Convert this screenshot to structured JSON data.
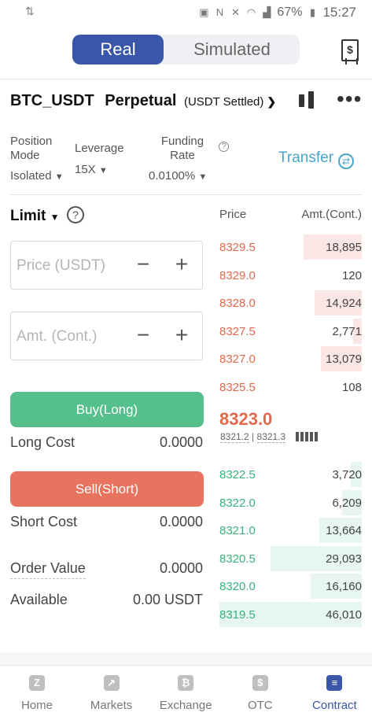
{
  "status_bar": {
    "battery": "67%",
    "time": "15:27"
  },
  "mode_tabs": [
    {
      "label": "Real",
      "active": true
    },
    {
      "label": "Simulated",
      "active": false
    }
  ],
  "contract": {
    "symbol": "BTC_USDT",
    "type": "Perpetual",
    "settlement": "(USDT Settled)"
  },
  "info": {
    "position_mode": {
      "label_line1": "Position",
      "label_line2": "Mode",
      "value": "Isolated"
    },
    "leverage": {
      "label": "Leverage",
      "value": "15X"
    },
    "funding_rate": {
      "label_line1": "Funding",
      "label_line2": "Rate",
      "value": "0.0100%"
    },
    "transfer_label": "Transfer"
  },
  "order_form": {
    "order_type": "Limit",
    "price_placeholder": "Price (USDT)",
    "amount_placeholder": "Amt. (Cont.)",
    "minus": "−",
    "plus": "+",
    "buy_label": "Buy(Long)",
    "long_cost_label": "Long Cost",
    "long_cost_value": "0.0000",
    "sell_label": "Sell(Short)",
    "short_cost_label": "Short Cost",
    "short_cost_value": "0.0000",
    "order_value_label": "Order Value",
    "order_value_value": "0.0000",
    "available_label": "Available",
    "available_value": "0.00 USDT"
  },
  "orderbook": {
    "price_header": "Price",
    "amount_header": "Amt.(Cont.)",
    "asks": [
      {
        "price": "8329.5",
        "amount": "18,895",
        "depth": 0.41
      },
      {
        "price": "8329.0",
        "amount": "120",
        "depth": 0.0
      },
      {
        "price": "8328.0",
        "amount": "14,924",
        "depth": 0.33
      },
      {
        "price": "8327.5",
        "amount": "2,771",
        "depth": 0.06
      },
      {
        "price": "8327.0",
        "amount": "13,079",
        "depth": 0.29
      },
      {
        "price": "8325.5",
        "amount": "108",
        "depth": 0.0
      }
    ],
    "last_price": "8323.0",
    "mark_price": "8321.2",
    "index_price": "8321.3",
    "separator": "|",
    "bids": [
      {
        "price": "8322.5",
        "amount": "3,720",
        "depth": 0.08
      },
      {
        "price": "8322.0",
        "amount": "6,209",
        "depth": 0.14
      },
      {
        "price": "8321.0",
        "amount": "13,664",
        "depth": 0.3
      },
      {
        "price": "8320.5",
        "amount": "29,093",
        "depth": 0.64
      },
      {
        "price": "8320.0",
        "amount": "16,160",
        "depth": 0.36
      },
      {
        "price": "8319.5",
        "amount": "46,010",
        "depth": 1.0
      }
    ]
  },
  "bottom_nav": [
    {
      "label": "Home",
      "icon": "home-icon",
      "glyph": "Z",
      "active": false
    },
    {
      "label": "Markets",
      "icon": "chart-icon",
      "glyph": "↗",
      "active": false
    },
    {
      "label": "Exchange",
      "icon": "bitcoin-icon",
      "glyph": "₿",
      "active": false
    },
    {
      "label": "OTC",
      "icon": "dollar-icon",
      "glyph": "$",
      "active": false
    },
    {
      "label": "Contract",
      "icon": "contract-icon",
      "glyph": "≡",
      "active": true
    }
  ],
  "colors": {
    "accent": "#3a56a8",
    "buy": "#56c08d",
    "sell": "#e8735e",
    "ask_text": "#e0694d",
    "bid_text": "#3bb27f",
    "link": "#4aa5c9"
  }
}
